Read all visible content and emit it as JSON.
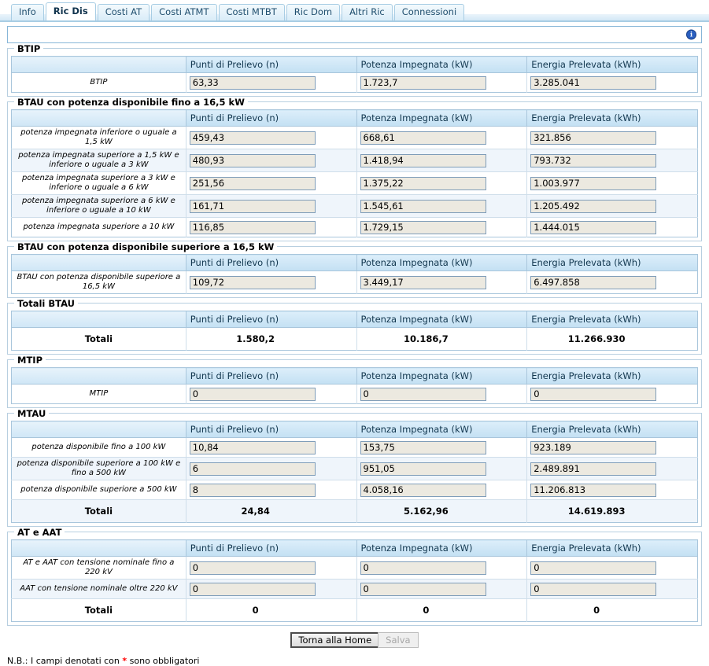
{
  "tabs": [
    {
      "label": "Info",
      "active": false
    },
    {
      "label": "Ric Dis",
      "active": true
    },
    {
      "label": "Costi AT",
      "active": false
    },
    {
      "label": "Costi ATMT",
      "active": false
    },
    {
      "label": "Costi MTBT",
      "active": false
    },
    {
      "label": "Ric Dom",
      "active": false
    },
    {
      "label": "Altri Ric",
      "active": false
    },
    {
      "label": "Connessioni",
      "active": false
    }
  ],
  "infobar": {
    "value": "",
    "icon": "info-icon"
  },
  "columns": {
    "label": "",
    "punti": "Punti di Prelievo (n)",
    "potenza": "Potenza Impegnata (kW)",
    "energia": "Energia Prelevata (kWh)"
  },
  "sections": [
    {
      "title": "BTIP",
      "rows": [
        {
          "label": "BTIP",
          "punti": "63,33",
          "potenza": "1.723,7",
          "energia": "3.285.041",
          "type": "input"
        }
      ]
    },
    {
      "title": "BTAU con potenza disponibile fino a 16,5 kW",
      "rows": [
        {
          "label": "potenza impegnata inferiore o uguale a 1,5 kW",
          "punti": "459,43",
          "potenza": "668,61",
          "energia": "321.856",
          "type": "input"
        },
        {
          "label": "potenza impegnata superiore a 1,5 kW e inferiore o uguale a 3 kW",
          "punti": "480,93",
          "potenza": "1.418,94",
          "energia": "793.732",
          "type": "input"
        },
        {
          "label": "potenza impegnata superiore a 3 kW e inferiore o uguale a 6 kW",
          "punti": "251,56",
          "potenza": "1.375,22",
          "energia": "1.003.977",
          "type": "input"
        },
        {
          "label": "potenza impegnata superiore a 6 kW e inferiore o uguale a 10 kW",
          "punti": "161,71",
          "potenza": "1.545,61",
          "energia": "1.205.492",
          "type": "input"
        },
        {
          "label": "potenza impegnata superiore a 10 kW",
          "punti": "116,85",
          "potenza": "1.729,15",
          "energia": "1.444.015",
          "type": "input"
        }
      ]
    },
    {
      "title": "BTAU con potenza disponibile superiore a 16,5 kW",
      "rows": [
        {
          "label": "BTAU con potenza disponibile superiore a 16,5 kW",
          "punti": "109,72",
          "potenza": "3.449,17",
          "energia": "6.497.858",
          "type": "input"
        }
      ]
    },
    {
      "title": "Totali BTAU",
      "rows": [
        {
          "label": "Totali",
          "punti": "1.580,2",
          "potenza": "10.186,7",
          "energia": "11.266.930",
          "type": "total"
        }
      ]
    },
    {
      "title": "MTIP",
      "rows": [
        {
          "label": "MTIP",
          "punti": "0",
          "potenza": "0",
          "energia": "0",
          "type": "input"
        }
      ]
    },
    {
      "title": "MTAU",
      "rows": [
        {
          "label": "potenza disponibile fino a 100 kW",
          "punti": "10,84",
          "potenza": "153,75",
          "energia": "923.189",
          "type": "input"
        },
        {
          "label": "potenza disponibile superiore a 100 kW e fino a 500 kW",
          "punti": "6",
          "potenza": "951,05",
          "energia": "2.489.891",
          "type": "input"
        },
        {
          "label": "potenza disponibile superiore a 500 kW",
          "punti": "8",
          "potenza": "4.058,16",
          "energia": "11.206.813",
          "type": "input"
        },
        {
          "label": "Totali",
          "punti": "24,84",
          "potenza": "5.162,96",
          "energia": "14.619.893",
          "type": "total"
        }
      ]
    },
    {
      "title": "AT e AAT",
      "rows": [
        {
          "label": "AT e AAT con tensione nominale fino a 220 kV",
          "punti": "0",
          "potenza": "0",
          "energia": "0",
          "type": "input"
        },
        {
          "label": "AAT con tensione nominale oltre 220 kV",
          "punti": "0",
          "potenza": "0",
          "energia": "0",
          "type": "input"
        },
        {
          "label": "Totali",
          "punti": "0",
          "potenza": "0",
          "energia": "0",
          "type": "total"
        }
      ]
    }
  ],
  "footer": {
    "home_button": "Torna alla Home",
    "save_button": "Salva",
    "save_disabled": true,
    "note_prefix": "N.B.: I campi denotati con ",
    "note_marker": "*",
    "note_suffix": " sono obbligatori",
    "marker_color": "#ff0000"
  }
}
